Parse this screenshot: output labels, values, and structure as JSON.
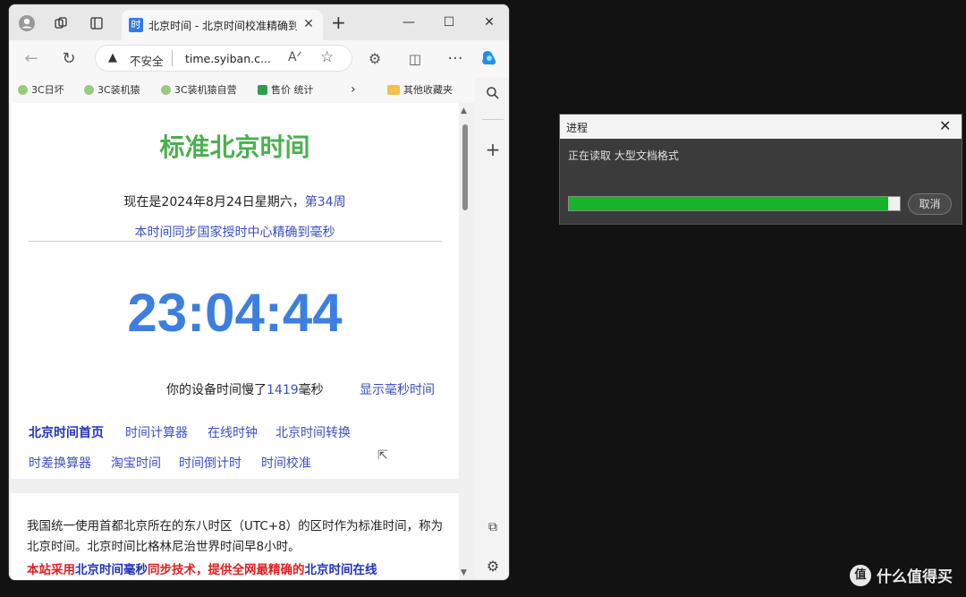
{
  "browser": {
    "tab_title": "北京时间 - 北京时间校准精确到毫秒",
    "tab_favicon_text": "时",
    "address": {
      "security_label": "不安全",
      "url": "time.syiban.c..."
    },
    "bookmarks": [
      "3C日坏",
      "3C装机猿",
      "3C装机猿自营",
      "售价 统计",
      "其他收藏夹"
    ]
  },
  "page": {
    "title": "标准北京时间",
    "date_prefix": "现在是2024年8月24日星期六，",
    "week": "第34周",
    "sync_note": "本时间同步国家授时中心精确到毫秒",
    "clock": "23:04:44",
    "offset_prefix": "你的设备时间慢了",
    "offset_ms": "1419",
    "offset_suffix": "毫秒",
    "show_ms_link": "显示毫秒时间",
    "links_row1": [
      "北京时间首页",
      "时间计算器",
      "在线时钟",
      "北京时间转换"
    ],
    "links_row2": [
      "时差换算器",
      "淘宝时间",
      "时间倒计时",
      "时间校准"
    ],
    "intro_text": "我国统一使用首都北京所在的东八时区（UTC+8）的区时作为标准时间，称为北京时间。北京时间比格林尼治世界时间早8小时。",
    "intro_bold_1": "本站采用",
    "intro_bold_blue": "北京时间毫秒",
    "intro_bold_2": "同步技术，提供全网最精确的",
    "intro_bold_blue2": "北京时间在线"
  },
  "dialog": {
    "title": "进程",
    "message": "正在读取 大型文档格式",
    "progress_fraction": 0.965,
    "cancel_label": "取消"
  },
  "watermark": {
    "logo_text": "值",
    "text": "什么值得买"
  },
  "colors": {
    "title_green": "#4caf50",
    "clock_blue": "#3d7fe0",
    "link_blue": "#3a4fc4",
    "progress_green": "#15b52a"
  }
}
